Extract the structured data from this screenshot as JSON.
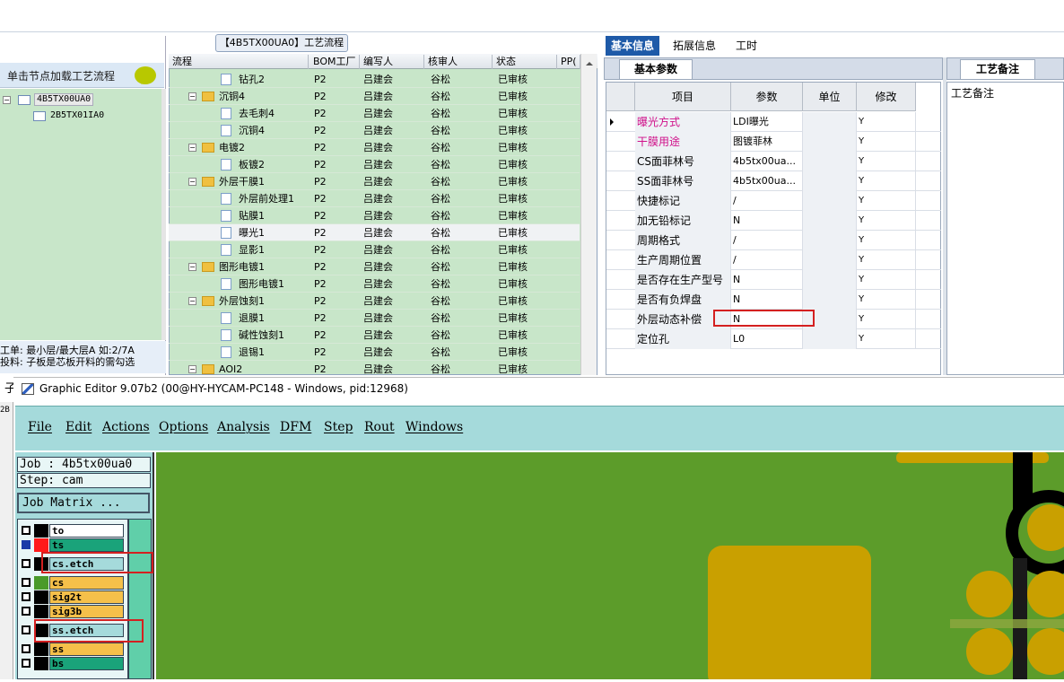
{
  "left_panel": {
    "load_label": "单击节点加载工艺流程",
    "tree": [
      "4B5TX00UA0",
      "2B5TX01IA0"
    ],
    "info_lines": [
      "工单: 最小层/最大层A 如:2/7A",
      "投料: 子板是芯板开料的需勾选"
    ],
    "cut_label_1": "子",
    "cut_label_2": "2B"
  },
  "process": {
    "title": "【4B5TX00UA0】工艺流程",
    "headers": [
      "流程",
      "BOM工厂",
      "编写人",
      "核审人",
      "状态",
      "PP("
    ],
    "rows": [
      {
        "name": "钻孔2",
        "type": "doc",
        "level": 2,
        "bom": "P2",
        "writer": "吕建会",
        "reviewer": "谷松",
        "status": "已审核"
      },
      {
        "name": "沉铜4",
        "type": "folder",
        "level": 1,
        "bom": "P2",
        "writer": "吕建会",
        "reviewer": "谷松",
        "status": "已审核"
      },
      {
        "name": "去毛刺4",
        "type": "doc",
        "level": 2,
        "bom": "P2",
        "writer": "吕建会",
        "reviewer": "谷松",
        "status": "已审核"
      },
      {
        "name": "沉铜4",
        "type": "doc",
        "level": 2,
        "bom": "P2",
        "writer": "吕建会",
        "reviewer": "谷松",
        "status": "已审核"
      },
      {
        "name": "电镀2",
        "type": "folder",
        "level": 1,
        "bom": "P2",
        "writer": "吕建会",
        "reviewer": "谷松",
        "status": "已审核"
      },
      {
        "name": "板镀2",
        "type": "doc",
        "level": 2,
        "bom": "P2",
        "writer": "吕建会",
        "reviewer": "谷松",
        "status": "已审核"
      },
      {
        "name": "外层干膜1",
        "type": "folder",
        "level": 1,
        "bom": "P2",
        "writer": "吕建会",
        "reviewer": "谷松",
        "status": "已审核"
      },
      {
        "name": "外层前处理1",
        "type": "doc",
        "level": 2,
        "bom": "P2",
        "writer": "吕建会",
        "reviewer": "谷松",
        "status": "已审核"
      },
      {
        "name": "贴膜1",
        "type": "doc",
        "level": 2,
        "bom": "P2",
        "writer": "吕建会",
        "reviewer": "谷松",
        "status": "已审核"
      },
      {
        "name": "曝光1",
        "type": "doc",
        "level": 2,
        "bom": "P2",
        "writer": "吕建会",
        "reviewer": "谷松",
        "status": "已审核",
        "selected": true
      },
      {
        "name": "显影1",
        "type": "doc",
        "level": 2,
        "bom": "P2",
        "writer": "吕建会",
        "reviewer": "谷松",
        "status": "已审核"
      },
      {
        "name": "图形电镀1",
        "type": "folder",
        "level": 1,
        "bom": "P2",
        "writer": "吕建会",
        "reviewer": "谷松",
        "status": "已审核"
      },
      {
        "name": "图形电镀1",
        "type": "doc",
        "level": 2,
        "bom": "P2",
        "writer": "吕建会",
        "reviewer": "谷松",
        "status": "已审核"
      },
      {
        "name": "外层蚀刻1",
        "type": "folder",
        "level": 1,
        "bom": "P2",
        "writer": "吕建会",
        "reviewer": "谷松",
        "status": "已审核"
      },
      {
        "name": "退膜1",
        "type": "doc",
        "level": 2,
        "bom": "P2",
        "writer": "吕建会",
        "reviewer": "谷松",
        "status": "已审核"
      },
      {
        "name": "碱性蚀刻1",
        "type": "doc",
        "level": 2,
        "bom": "P2",
        "writer": "吕建会",
        "reviewer": "谷松",
        "status": "已审核"
      },
      {
        "name": "退锡1",
        "type": "doc",
        "level": 2,
        "bom": "P2",
        "writer": "吕建会",
        "reviewer": "谷松",
        "status": "已审核"
      },
      {
        "name": "AOI2",
        "type": "folder",
        "level": 1,
        "bom": "P2",
        "writer": "吕建会",
        "reviewer": "谷松",
        "status": "已审核"
      }
    ]
  },
  "info_panel": {
    "tabs": [
      "基本信息",
      "拓展信息",
      "工时"
    ],
    "section_title": "基本参数",
    "headers": [
      "项目",
      "参数",
      "单位",
      "修改"
    ],
    "rows": [
      {
        "name": "曝光方式",
        "value": "LDI曝光",
        "unit": "",
        "mod": "Y",
        "pink": true
      },
      {
        "name": "干膜用途",
        "value": "图镀菲林",
        "unit": "",
        "mod": "Y",
        "pink": true
      },
      {
        "name": "CS面菲林号",
        "value": "4b5tx00ua...",
        "unit": "",
        "mod": "Y"
      },
      {
        "name": "SS面菲林号",
        "value": "4b5tx00ua...",
        "unit": "",
        "mod": "Y"
      },
      {
        "name": "快捷标记",
        "value": "/",
        "unit": "",
        "mod": "Y"
      },
      {
        "name": "加无铅标记",
        "value": "N",
        "unit": "",
        "mod": "Y"
      },
      {
        "name": "周期格式",
        "value": "/",
        "unit": "",
        "mod": "Y"
      },
      {
        "name": "生产周期位置",
        "value": "/",
        "unit": "",
        "mod": "Y"
      },
      {
        "name": "是否存在生产型号",
        "value": "N",
        "unit": "",
        "mod": "Y"
      },
      {
        "name": "是否有负焊盘",
        "value": "N",
        "unit": "",
        "mod": "Y"
      },
      {
        "name": "外层动态补偿",
        "value": "N",
        "unit": "",
        "mod": "Y"
      },
      {
        "name": "定位孔",
        "value": "L0",
        "unit": "",
        "mod": "Y"
      }
    ],
    "notes_title": "工艺备注",
    "notes_label": "工艺备注"
  },
  "graphic_editor": {
    "title": "Graphic Editor 9.07b2 (00@HY-HYCAM-PC148 - Windows, pid:12968)",
    "menu": [
      "File",
      "Edit",
      "Actions",
      "Options",
      "Analysis",
      "DFM",
      "Step",
      "Rout",
      "Windows"
    ],
    "job": "Job : 4b5tx00ua0",
    "step": "Step: cam",
    "job_matrix": "Job Matrix ...",
    "layers": [
      {
        "name": "to",
        "color": "#000000",
        "bg": "#ffffff"
      },
      {
        "name": "ts",
        "color": "#ff1a1a",
        "bg": "#1aa37a",
        "checked": true
      },
      {
        "name": "cs.etch",
        "color": "#000000",
        "bg": "#a5dadb"
      },
      {
        "name": "cs",
        "color": "#4a9a2a",
        "bg": "#f5c04a"
      },
      {
        "name": "sig2t",
        "color": "#000000",
        "bg": "#f5c04a"
      },
      {
        "name": "sig3b",
        "color": "#000000",
        "bg": "#f5c04a"
      },
      {
        "name": "ss.etch",
        "color": "#000000",
        "bg": "#a5dadb"
      },
      {
        "name": "ss",
        "color": "#000000",
        "bg": "#f5c04a"
      },
      {
        "name": "bs",
        "color": "#000000",
        "bg": "#1aa37a"
      }
    ]
  },
  "colors": {
    "accent": "#1e5aa8",
    "pink": "#d0108a",
    "highlight": "#d42020",
    "grid_green": "#c8e6c9",
    "editor_teal": "#a5dadb",
    "pcb_green": "#5c9c2a",
    "pad_gold": "#c9a000"
  }
}
